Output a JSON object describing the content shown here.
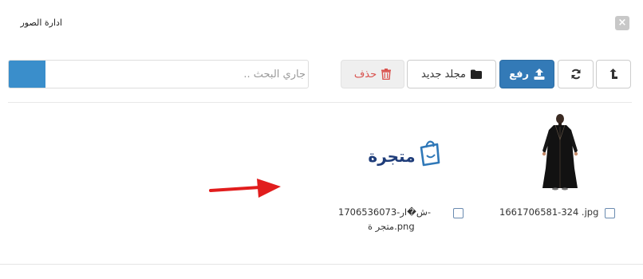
{
  "modal": {
    "title": "ادارة الصور",
    "close_label": "×"
  },
  "toolbar": {
    "upload_label": "رفع",
    "new_folder_label": "مجلد جديد",
    "delete_label": "حذف"
  },
  "search": {
    "placeholder": "جاري البحث .."
  },
  "items": [
    {
      "name": "1661706581-324 .jpg"
    },
    {
      "name_line1": "1706536073-ش�ار-",
      "name_line2": "متجر ة.png"
    }
  ],
  "brand": {
    "logo_text": "متجرة"
  },
  "colors": {
    "primary": "#337ab7",
    "search_button": "#3a8ecb",
    "danger": "#d9534f",
    "brand_navy": "#1f3d7a",
    "arrow": "#e11d1d"
  }
}
